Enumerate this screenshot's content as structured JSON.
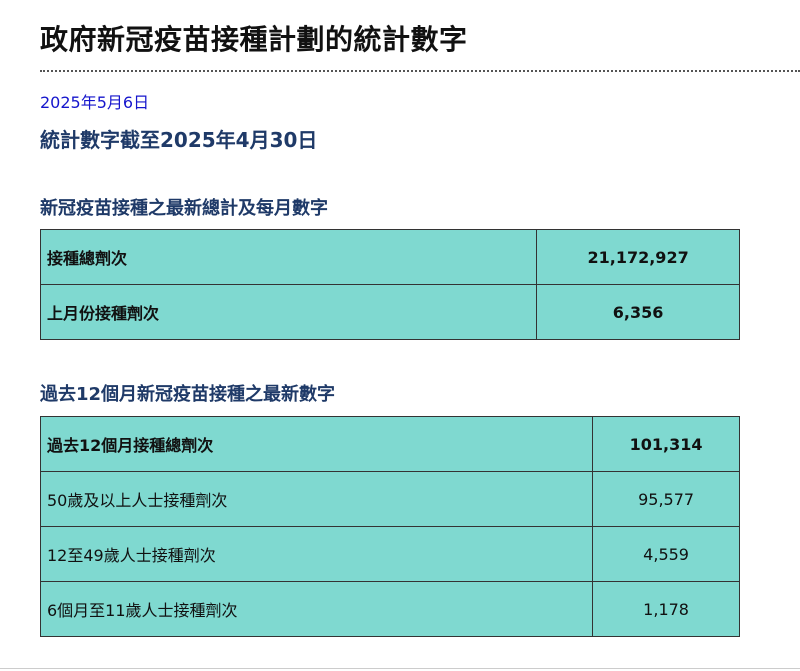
{
  "page": {
    "title": "政府新冠疫苗接種計劃的統計數字",
    "publish_date": "2025年5月6日",
    "stats_as_of": "統計數字截至2025年4月30日"
  },
  "section1": {
    "heading": "新冠疫苗接種之最新總計及每月數字",
    "rows": [
      {
        "label": "接種總劑次",
        "value": "21,172,927"
      },
      {
        "label": "上月份接種劑次",
        "value": "6,356"
      }
    ]
  },
  "section2": {
    "heading": "過去12個月新冠疫苗接種之最新數字",
    "rows": [
      {
        "label": "過去12個月接種總劑次",
        "value": "101,314"
      },
      {
        "label": "50歲及以上人士接種劑次",
        "value": "95,577"
      },
      {
        "label": "12至49歲人士接種劑次",
        "value": "4,559"
      },
      {
        "label": "6個月至11歲人士接種劑次",
        "value": "1,178"
      }
    ]
  },
  "colors": {
    "table_background": "#7fd9d0",
    "heading_color": "#1f3a68",
    "date_color": "#1515cc"
  }
}
